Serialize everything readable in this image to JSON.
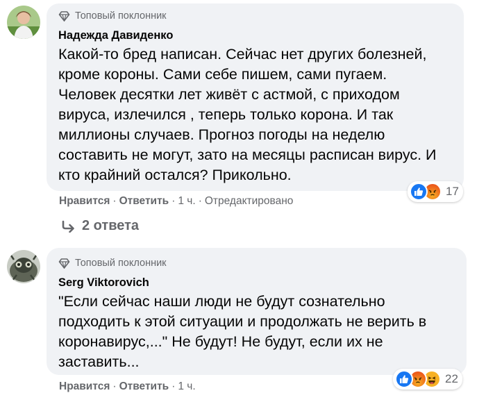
{
  "comments": [
    {
      "badge": "Топовый поклонник",
      "author": "Надежда Давиденко",
      "text": "Какой-то бред написан. Сейчас нет других болезней,\nкроме короны. Сами себе пишем, сами пугаем.\nЧеловек десятки лет живёт с астмой, с приходом\nвируса, излечился , теперь только корона. И так\nмиллионы случаев. Прогноз погоды на неделю\nсоставить не могут, зато на месяцы расписан вирус. И\nкто крайний остался? Прикольно.",
      "reactions": {
        "icons": [
          "like",
          "angry"
        ],
        "count": "17"
      },
      "actions": {
        "like": "Нравится",
        "reply": "Ответить",
        "time": "1 ч.",
        "edited": "Отредактировано"
      },
      "replies": "2 ответа"
    },
    {
      "badge": "Топовый поклонник",
      "author": "Serg Viktorovich",
      "text": "\"Если сейчас наши люди не будут сознательно\nподходить к этой ситуации и продолжать не верить в\nкоронавирус,...\" Не будут! Не будут, если их не\nзаставить...",
      "reactions": {
        "icons": [
          "like",
          "angry",
          "haha"
        ],
        "count": "22"
      },
      "actions": {
        "like": "Нравится",
        "reply": "Ответить",
        "time": "1 ч."
      }
    }
  ],
  "colors": {
    "bubble": "#f0f2f5",
    "meta": "#65676b",
    "like": "#1877f2",
    "angry": "#e9710f",
    "haha": "#f7b125"
  }
}
